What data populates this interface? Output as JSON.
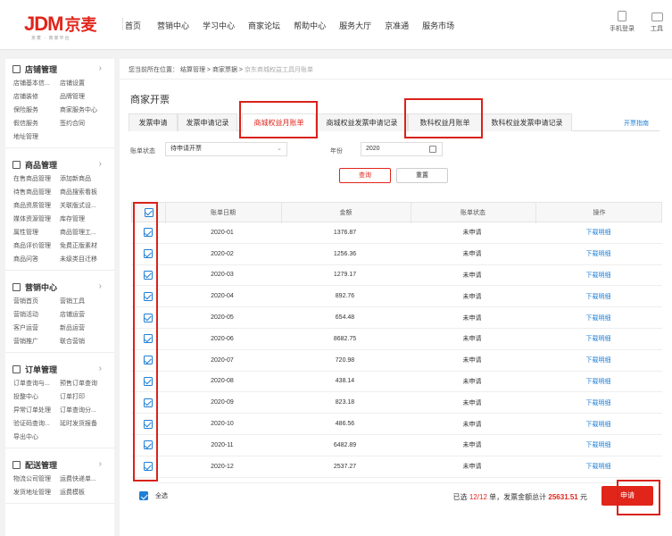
{
  "header": {
    "logo_text": "JDM",
    "logo_cn": "京麦",
    "logo_sub": "京麦 · 商家平台",
    "nav": [
      "首页",
      "营销中心",
      "学习中心",
      "商家论坛",
      "帮助中心",
      "服务大厅",
      "京准通",
      "服务市场"
    ],
    "tools": [
      {
        "label": "手机登录",
        "icon": "mobile-icon"
      },
      {
        "label": "工具",
        "icon": "toolbox-icon"
      }
    ]
  },
  "sidebar": {
    "sections": [
      {
        "title": "店铺管理",
        "icon": "store-icon",
        "links": [
          "店铺基本信...",
          "店铺装修",
          "保险服务",
          "假信服务",
          "地址管理",
          "店铺设置",
          "品牌管理",
          "商家服务中心",
          "签约合同"
        ]
      },
      {
        "title": "商品管理",
        "icon": "goods-icon",
        "links": [
          "在售商品管理",
          "待售商品管理",
          "商品资质管理",
          "媒体资源管理",
          "属性管理",
          "商品评价管理",
          "商品问答",
          "添加新商品",
          "商品搜索看板",
          "关联版式设...",
          "库存管理",
          "商品管理工...",
          "免费正版素材",
          "未级类目迁移"
        ]
      },
      {
        "title": "营销中心",
        "icon": "marketing-icon",
        "links": [
          "营销首页",
          "营销活动",
          "客户运营",
          "营销推广",
          "营销工具",
          "店铺运营",
          "新品运营",
          "联合营销"
        ]
      },
      {
        "title": "订单管理",
        "icon": "order-icon",
        "links": [
          "订单查询与...",
          "投整中心",
          "异常订单处理",
          "验证码查询...",
          "导出中心",
          "预售订单查询",
          "订单打印",
          "订单查询分...",
          "延时发货报备"
        ]
      },
      {
        "title": "配送管理",
        "icon": "delivery-icon",
        "links": [
          "物流公司管理",
          "发货地址管理",
          "运费快递单...",
          "运费模板"
        ]
      }
    ]
  },
  "breadcrumb": {
    "prefix": "您当前所在位置：",
    "items": [
      "结算管理",
      "商家票据",
      "京东商城权益工具月账单"
    ]
  },
  "page_title": "商家开票",
  "tabs": [
    "发票申请",
    "发票申请记录",
    "商城权益月账单",
    "商城权益发票申请记录",
    "数科权益月账单",
    "数科权益发票申请记录"
  ],
  "active_tab": 2,
  "tab_link": "开票指南",
  "filters": {
    "status_label": "账单状态",
    "status_value": "待申请开票",
    "year_label": "年份",
    "year_value": "2020"
  },
  "buttons": {
    "query": "查询",
    "reset": "重置",
    "apply": "申请"
  },
  "table": {
    "headers": [
      "账单日期",
      "金额",
      "账单状态",
      "操作"
    ],
    "rows": [
      {
        "date": "2020-01",
        "amount": "1376.87",
        "status": "未申请",
        "action": "下载明细"
      },
      {
        "date": "2020-02",
        "amount": "1256.36",
        "status": "未申请",
        "action": "下载明细"
      },
      {
        "date": "2020-03",
        "amount": "1279.17",
        "status": "未申请",
        "action": "下载明细"
      },
      {
        "date": "2020-04",
        "amount": "892.76",
        "status": "未申请",
        "action": "下载明细"
      },
      {
        "date": "2020-05",
        "amount": "654.48",
        "status": "未申请",
        "action": "下载明细"
      },
      {
        "date": "2020-06",
        "amount": "8682.75",
        "status": "未申请",
        "action": "下载明细"
      },
      {
        "date": "2020-07",
        "amount": "720.98",
        "status": "未申请",
        "action": "下载明细"
      },
      {
        "date": "2020-08",
        "amount": "438.14",
        "status": "未申请",
        "action": "下载明细"
      },
      {
        "date": "2020-09",
        "amount": "823.18",
        "status": "未申请",
        "action": "下载明细"
      },
      {
        "date": "2020-10",
        "amount": "486.56",
        "status": "未申请",
        "action": "下载明细"
      },
      {
        "date": "2020-11",
        "amount": "6482.89",
        "status": "未申请",
        "action": "下载明细"
      },
      {
        "date": "2020-12",
        "amount": "2537.27",
        "status": "未申请",
        "action": "下载明细"
      }
    ]
  },
  "footer": {
    "select_all": "全选",
    "sum_prefix": "已选",
    "selected": "12",
    "sep": "/",
    "total": "12",
    "sum_mid": "单，发票金额总计",
    "amount": "25631.51",
    "sum_suffix": "元"
  }
}
